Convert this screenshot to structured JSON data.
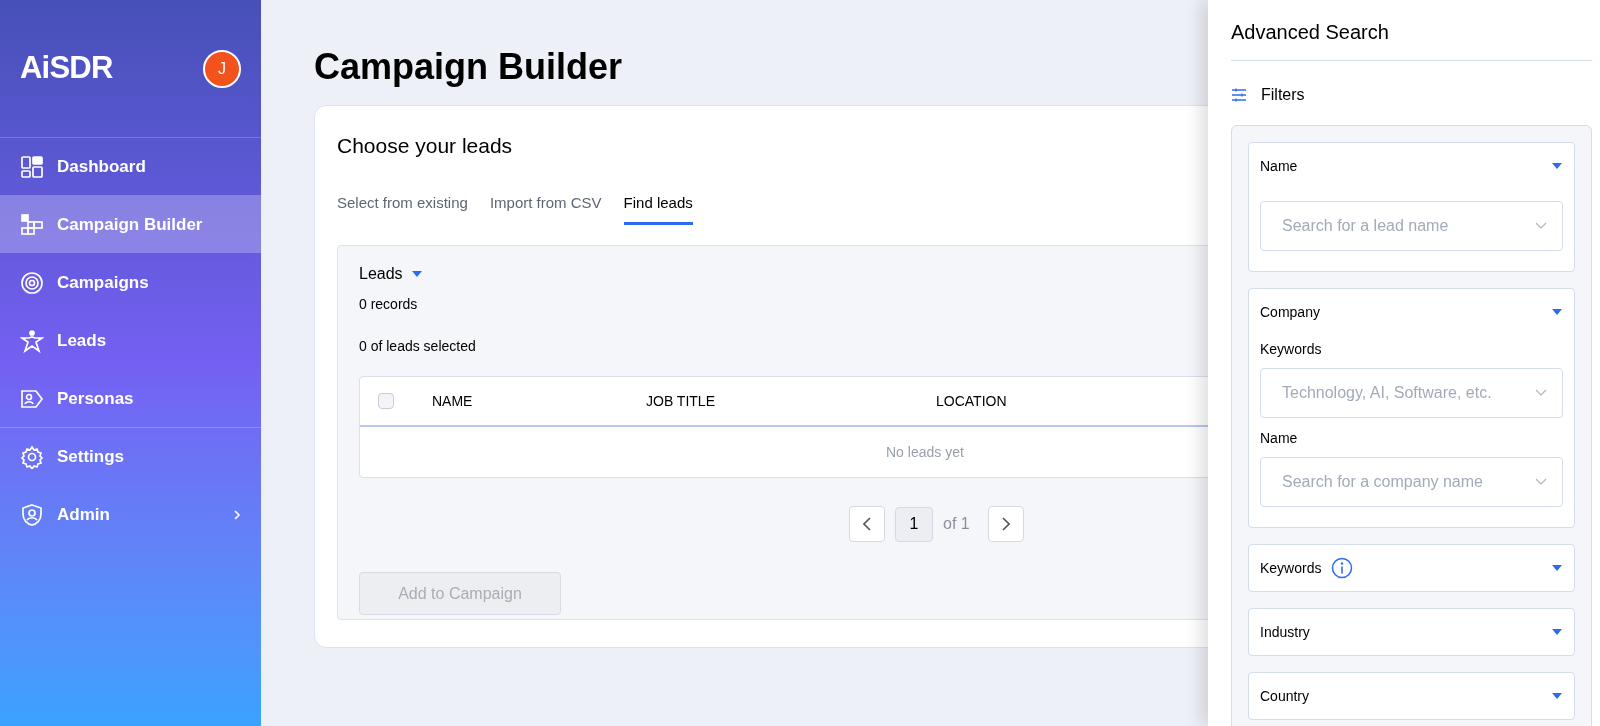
{
  "sidebar": {
    "logo": "AiSDR",
    "avatar": "J",
    "items": [
      {
        "label": "Dashboard",
        "selected": false,
        "divider_before": true,
        "submenu": false
      },
      {
        "label": "Campaign Builder",
        "selected": true,
        "divider_before": false,
        "submenu": false
      },
      {
        "label": "Campaigns",
        "selected": false,
        "divider_before": false,
        "submenu": false
      },
      {
        "label": "Leads",
        "selected": false,
        "divider_before": false,
        "submenu": false
      },
      {
        "label": "Personas",
        "selected": false,
        "divider_before": false,
        "submenu": false
      },
      {
        "label": "Settings",
        "selected": false,
        "divider_before": true,
        "submenu": false
      },
      {
        "label": "Admin",
        "selected": false,
        "divider_before": false,
        "submenu": true
      }
    ]
  },
  "page": {
    "title": "Campaign Builder"
  },
  "card": {
    "title": "Choose your leads",
    "tabs": [
      {
        "label": "Select from existing",
        "selected": false
      },
      {
        "label": "Import from CSV",
        "selected": false
      },
      {
        "label": "Find leads",
        "selected": true
      }
    ],
    "leads": {
      "title": "Leads",
      "records": "0 records",
      "selected_count": "0 of leads selected",
      "table": {
        "select_all_checked": false,
        "columns": [
          "NAME",
          "JOB TITLE",
          "LOCATION"
        ],
        "empty": "No leads yet"
      },
      "pagination": {
        "page": "1",
        "of": "of 1"
      },
      "add_button": {
        "label": "Add to Campaign",
        "disabled": true
      }
    }
  },
  "drawer": {
    "title": "Advanced Search",
    "filters_label": "Filters",
    "filters": [
      {
        "label": "Name",
        "info": false,
        "expanded": true,
        "fields": [
          {
            "placeholder": "Search for a lead name"
          }
        ]
      },
      {
        "label": "Company",
        "info": false,
        "expanded": true,
        "fields": [
          {
            "label": "Keywords",
            "placeholder": "Technology, AI, Software, etc."
          },
          {
            "label": "Name",
            "placeholder": "Search for a company name"
          }
        ]
      },
      {
        "label": "Keywords",
        "info": true,
        "expanded": false
      },
      {
        "label": "Industry",
        "info": false,
        "expanded": false
      },
      {
        "label": "Country",
        "info": false,
        "expanded": false
      }
    ]
  }
}
